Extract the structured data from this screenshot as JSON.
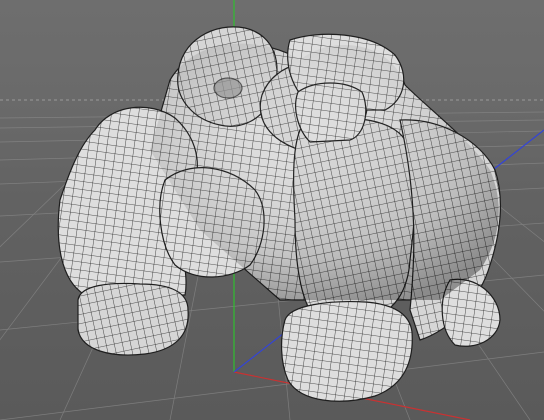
{
  "viewport": {
    "background_color": "#666666",
    "grid_color": "#8c8c8c",
    "axis_colors": {
      "x": "#c83232",
      "y": "#2fbf2f",
      "z": "#3344d6"
    }
  },
  "model": {
    "fill_color": "#dcdcdc",
    "wire_color": "#1e1e1e",
    "shading": "wireframe-on-shaded"
  }
}
